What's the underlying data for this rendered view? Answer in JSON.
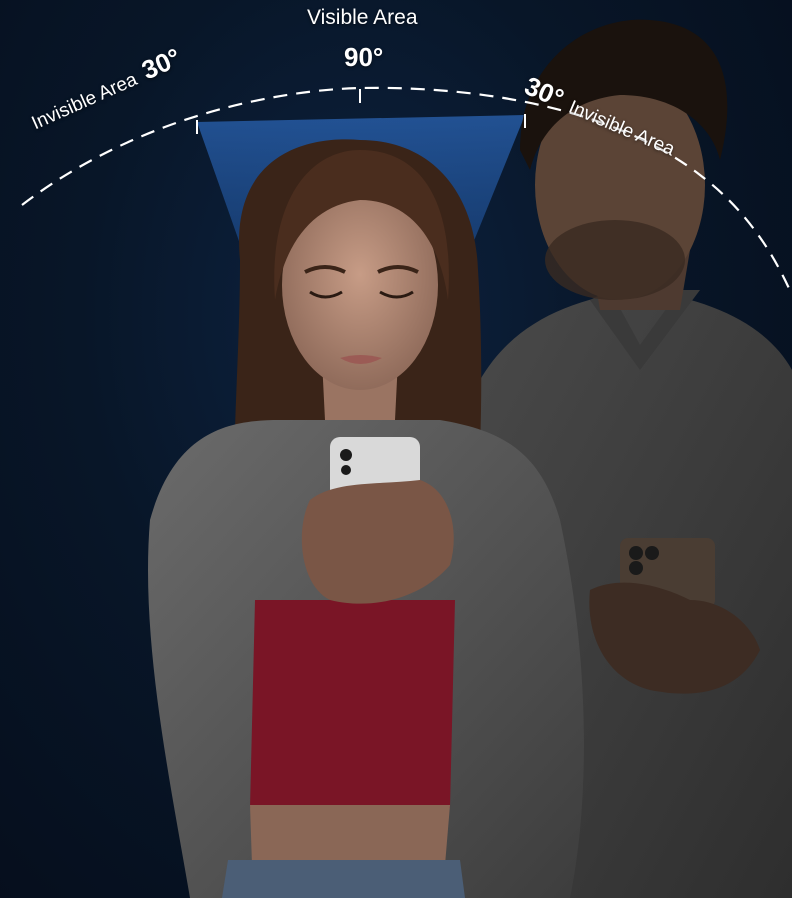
{
  "labels": {
    "visible_area": "Visible Area",
    "visible_angle": "90°",
    "left_invisible_text": "Invisible Area",
    "left_invisible_angle": "30°",
    "right_invisible_angle": "30°",
    "right_invisible_text": "Invisible Area"
  },
  "colors": {
    "background": "#081628",
    "cone": "#1f4f93",
    "arc": "#ffffff",
    "top_red": "#7a1526",
    "shirt_white": "#5a5a5a"
  }
}
